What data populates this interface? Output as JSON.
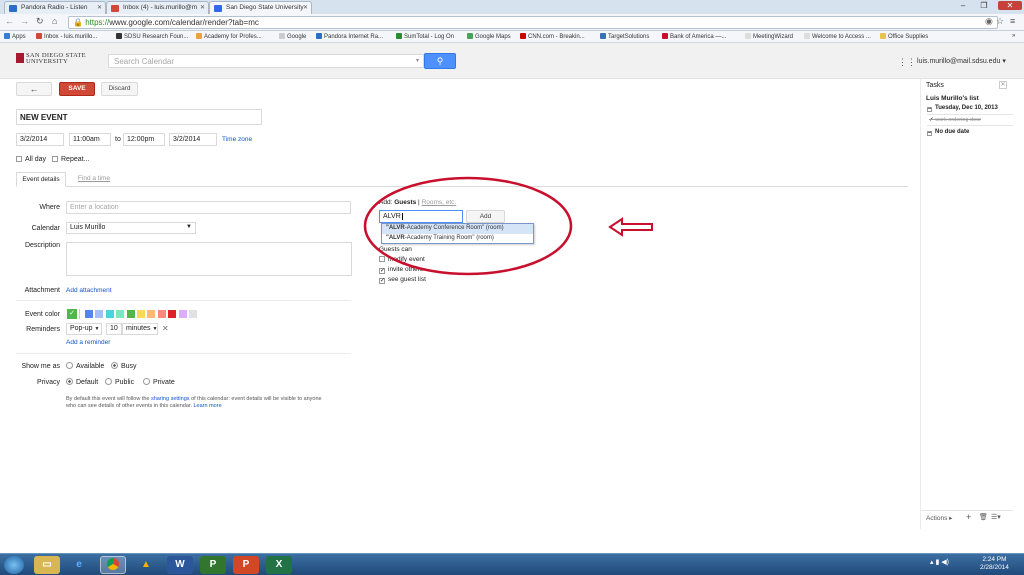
{
  "browser": {
    "tabs": [
      {
        "title": "Pandora Radio - Listen",
        "color": "#2a6ec6"
      },
      {
        "title": "Inbox (4) - luis.murillo@m",
        "color": "#d44638"
      },
      {
        "title": "San Diego State University",
        "color": "#3369e8"
      }
    ],
    "url_https": "https://",
    "url_rest": "www.google.com/calendar/render?tab=mc",
    "bookmarks": [
      "Apps",
      "Inbox - luis.murillo...",
      "SDSU Research Foun...",
      "Academy for Profes...",
      "Google",
      "Pandora Internet Ra...",
      "SumTotal - Log On",
      "Google Maps",
      "CNN.com - Breakin...",
      "TargetSolutions",
      "Bank of America —...",
      "MeetingWizard",
      "Welcome to Access ...",
      "Office Supplies"
    ]
  },
  "header": {
    "logo_line1": "SAN DIEGO STATE",
    "logo_line2": "UNIVERSITY",
    "search_placeholder": "Search Calendar",
    "user_email": "luis.murillo@mail.sdsu.edu"
  },
  "toolbar": {
    "back": "←",
    "save": "SAVE",
    "discard": "Discard"
  },
  "event": {
    "title": "NEW EVENT",
    "start_date": "3/2/2014",
    "start_time": "11:00am",
    "to": "to",
    "end_time": "12:00pm",
    "end_date": "3/2/2014",
    "timezone": "Time zone",
    "allday": "All day",
    "repeat": "Repeat..."
  },
  "tabs": {
    "details": "Event details",
    "find_time": "Find a time"
  },
  "form": {
    "where_label": "Where",
    "where_placeholder": "Enter a location",
    "calendar_label": "Calendar",
    "calendar_value": "Luis Murillo",
    "description_label": "Description",
    "attachment_label": "Attachment",
    "add_attachment": "Add attachment",
    "event_color_label": "Event color",
    "colors": [
      "#5484ed",
      "#a4bdfc",
      "#46d6db",
      "#7ae7bf",
      "#51b749",
      "#fbd75b",
      "#ffb878",
      "#ff887c",
      "#dc2127",
      "#dbadff",
      "#e1e1e1"
    ],
    "reminders_label": "Reminders",
    "reminder_type": "Pop-up",
    "reminder_amount": "10",
    "reminder_unit": "minutes",
    "add_reminder": "Add a reminder",
    "show_me_as_label": "Show me as",
    "available": "Available",
    "busy": "Busy",
    "privacy_label": "Privacy",
    "privacy_default": "Default",
    "privacy_public": "Public",
    "privacy_private": "Private",
    "note_part1": "By default this event will follow the",
    "note_link": "sharing settings",
    "note_part2": "of this calendar: event details will be visible to anyone",
    "note_line2": "who can see details of other events in this calendar.",
    "learn_more": "Learn more"
  },
  "guests": {
    "add_label": "Add:",
    "guests_tab": "Guests",
    "sep": "|",
    "rooms_tab": "Rooms, etc.",
    "input_value": "ALVR",
    "add_button": "Add",
    "suggestions": [
      {
        "bold": "\"ALVR",
        "rest": "-Academy Conference Room\" (room)"
      },
      {
        "bold": "\"ALVR",
        "rest": "-Academy Training Room\" (room)"
      }
    ],
    "guests_can": "Guests can",
    "modify": "modify event",
    "invite": "invite others",
    "see_list": "see guest list"
  },
  "tasks": {
    "title": "Tasks",
    "list_name": "Luis Murillo's list",
    "group1": "Tuesday, Dec 10, 2013",
    "item1": "work ordering door",
    "group2": "No due date",
    "actions": "Actions ▸"
  },
  "taskbar": {
    "time": "2:24 PM",
    "date": "2/28/2014"
  }
}
